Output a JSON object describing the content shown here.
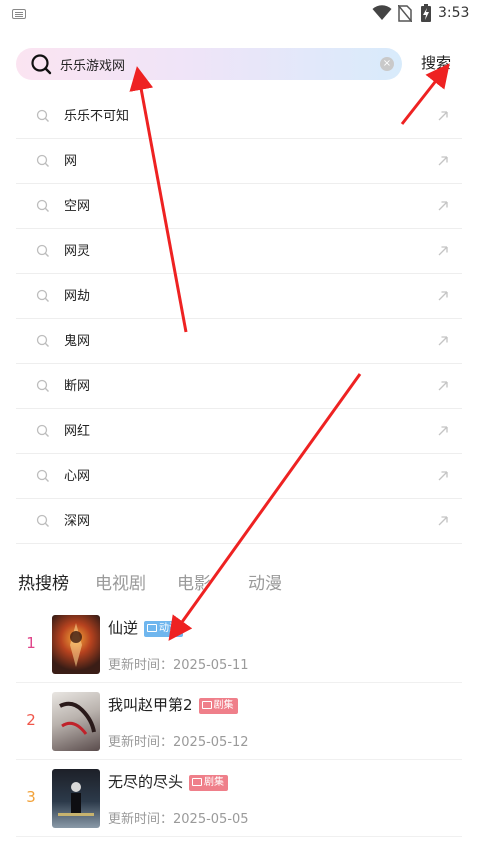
{
  "status_bar": {
    "time": "3:53"
  },
  "search": {
    "value": "乐乐游戏网",
    "button_label": "搜索"
  },
  "suggestions": [
    "乐乐不可知",
    "网",
    "空网",
    "网灵",
    "网劫",
    "鬼网",
    "断网",
    "网红",
    "心网",
    "深网"
  ],
  "tabs": [
    "热搜榜",
    "电视剧",
    "电影",
    "动漫"
  ],
  "ranking": [
    {
      "rank": "1",
      "title": "仙逆",
      "tag": "动漫",
      "time_label": "更新时间：",
      "date": "2025-05-11",
      "rank_color": "#e0458a",
      "tag_color": "#6fb6ee"
    },
    {
      "rank": "2",
      "title": "我叫赵甲第2",
      "tag": "剧集",
      "time_label": "更新时间：",
      "date": "2025-05-12",
      "rank_color": "#f0564a",
      "tag_color": "#ef7f8a"
    },
    {
      "rank": "3",
      "title": "无尽的尽头",
      "tag": "剧集",
      "time_label": "更新时间：",
      "date": "2025-05-05",
      "rank_color": "#f2a23a",
      "tag_color": "#ef7f8a"
    }
  ],
  "colors": {
    "annotation_arrow": "#ee2222"
  }
}
